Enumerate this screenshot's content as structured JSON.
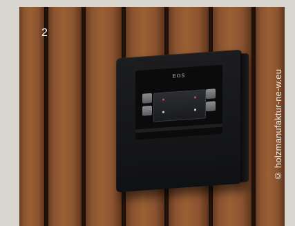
{
  "caption": {
    "number": "2",
    "credit": "© holzmanufaktur-ne-w.eu"
  },
  "device": {
    "brand": "EOS",
    "screen_accent": "#e0453a"
  },
  "colors": {
    "background": "#d9d5cf",
    "wood": "#8a5430",
    "gap": "#1a0d06",
    "device": "#161719"
  }
}
